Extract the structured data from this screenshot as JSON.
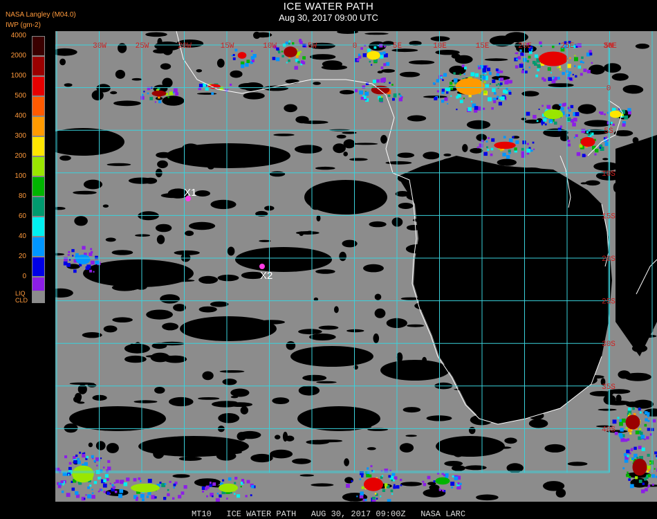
{
  "header": {
    "title": "ICE WATER PATH",
    "datetime": "Aug 30, 2017 09:00 UTC",
    "source": "NASA Langley (M04.0)",
    "units": "IWP (gm-2)"
  },
  "legend": {
    "levels": [
      {
        "label": "4000",
        "color": "#3a0000"
      },
      {
        "label": "2000",
        "color": "#9a0000"
      },
      {
        "label": "1000",
        "color": "#e60000"
      },
      {
        "label": "500",
        "color": "#ff5a00"
      },
      {
        "label": "400",
        "color": "#ff9a00"
      },
      {
        "label": "300",
        "color": "#ffe600"
      },
      {
        "label": "200",
        "color": "#9ae600"
      },
      {
        "label": "100",
        "color": "#00b400"
      },
      {
        "label": "80",
        "color": "#009a6e"
      },
      {
        "label": "60",
        "color": "#00f0f0"
      },
      {
        "label": "40",
        "color": "#0096ff"
      },
      {
        "label": "20",
        "color": "#0000e6"
      },
      {
        "label": "0",
        "color": "#8c1ee6"
      }
    ],
    "liquid_label_1": "LIQ",
    "liquid_label_2": "CLD",
    "liquid_color": "#8c8c8c"
  },
  "map": {
    "lat_labels": [
      "5N",
      "0",
      "5S",
      "10S",
      "15S",
      "20S",
      "25S",
      "30S",
      "35S",
      "40S"
    ],
    "lon_labels": [
      "30W",
      "25W",
      "20W",
      "15W",
      "10W",
      "5W",
      "0",
      "5E",
      "10E",
      "15E",
      "20E",
      "25E",
      "30E",
      "35E"
    ],
    "points": [
      {
        "label": "X1"
      },
      {
        "label": "X2"
      }
    ],
    "grid_color": "#3ad2dc",
    "cloud_color": "#8c8c8c",
    "coast_color": "#ffffff"
  },
  "footer": "MT10   ICE WATER PATH   AUG 30, 2017 09:00Z   NASA LARC"
}
